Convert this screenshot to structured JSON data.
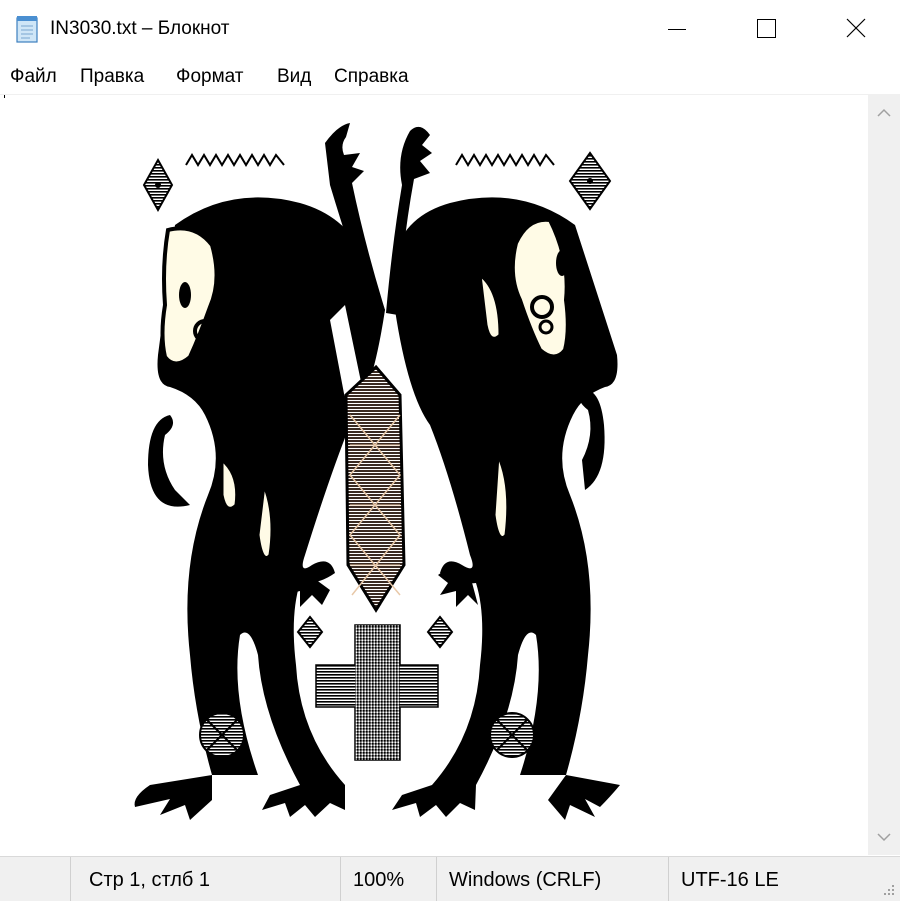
{
  "window": {
    "title": "IN3030.txt – Блокнот",
    "controls": {
      "minimize": "minimize-icon",
      "maximize": "maximize-icon",
      "close": "close-icon"
    }
  },
  "menu": {
    "items": [
      {
        "label": "Файл"
      },
      {
        "label": "Правка"
      },
      {
        "label": "Формат"
      },
      {
        "label": "Вид"
      },
      {
        "label": "Справка"
      }
    ]
  },
  "document": {
    "content": "ASCII/ANSI art: two mirrored black creatures with tails, claws and antler-like horns, flanking a lattice diamond, a striped cross and two crossed circles",
    "colors": {
      "ink": "#000000",
      "paper": "#ffffff",
      "highlight": "#fffbe6",
      "lattice": "#e8c8a8"
    }
  },
  "status": {
    "position": "Стр 1, стлб 1",
    "zoom": "100%",
    "line_endings": "Windows (CRLF)",
    "encoding": "UTF-16 LE"
  }
}
